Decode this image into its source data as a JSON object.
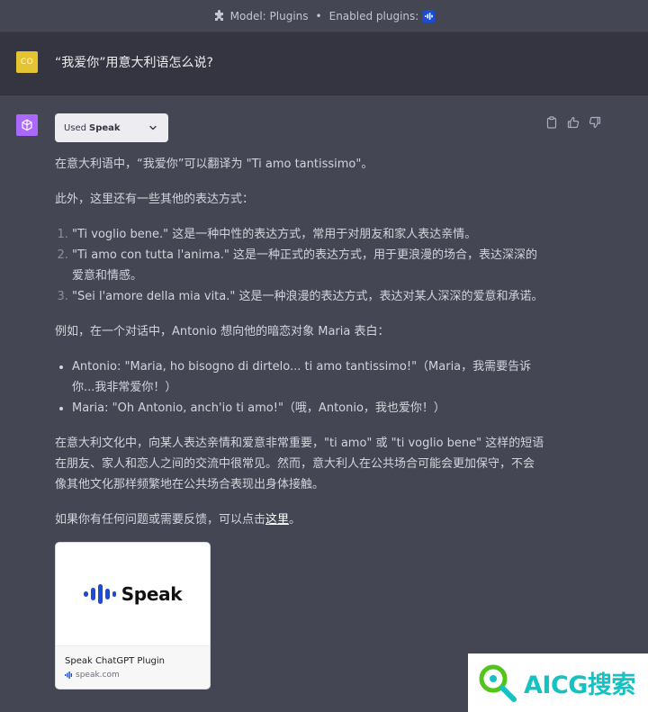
{
  "topbar": {
    "model_label": "Model: Plugins",
    "separator": "•",
    "enabled_label": "Enabled plugins:",
    "plugin_icon": "speak-plugin-icon"
  },
  "user_message": {
    "avatar_initials": "CO",
    "avatar_color": "#e5c432",
    "text": "“我爱你”用意大利语怎么说?"
  },
  "assistant": {
    "avatar_color": "#ab68ff",
    "used_plugin": {
      "prefix": "Used",
      "name": "Speak"
    },
    "actions": [
      "copy-icon",
      "thumbs-up-icon",
      "thumbs-down-icon"
    ],
    "paragraph_1": "在意大利语中，“我爱你”可以翻译为 \"Ti amo tantissimo\"。",
    "paragraph_2": "此外，这里还有一些其他的表达方式：",
    "ordered_list": [
      "\"Ti voglio bene.\" 这是一种中性的表达方式，常用于对朋友和家人表达亲情。",
      "\"Ti amo con tutta l'anima.\" 这是一种正式的表达方式，用于更浪漫的场合，表达深深的爱意和情感。",
      "\"Sei l'amore della mia vita.\" 这是一种浪漫的表达方式，表达对某人深深的爱意和承诺。"
    ],
    "paragraph_3": "例如，在一个对话中，Antonio 想向他的暗恋对象 Maria 表白：",
    "bullet_list": [
      "Antonio: \"Maria, ho bisogno di dirtelo... ti amo tantissimo!\"（Maria，我需要告诉你...我非常爱你！）",
      "Maria: \"Oh Antonio, anch'io ti amo!\"（哦，Antonio，我也爱你！）"
    ],
    "paragraph_4": "在意大利文化中，向某人表达亲情和爱意非常重要，\"ti amo\" 或 \"ti voglio bene\" 这样的短语在朋友、家人和恋人之间的交流中很常见。然而，意大利人在公共场合可能会更加保守，不会像其他文化那样频繁地在公共场合表现出身体接触。",
    "feedback_prefix": "如果你有任何问题或需要反馈，可以点击",
    "feedback_link": "这里",
    "feedback_suffix": "。",
    "card": {
      "logo_text": "Speak",
      "logo_color": "#1a4cd6",
      "title": "Speak ChatGPT Plugin",
      "domain": "speak.com"
    }
  },
  "watermark": {
    "text": "AICG搜索",
    "color": "#13c2c2"
  }
}
